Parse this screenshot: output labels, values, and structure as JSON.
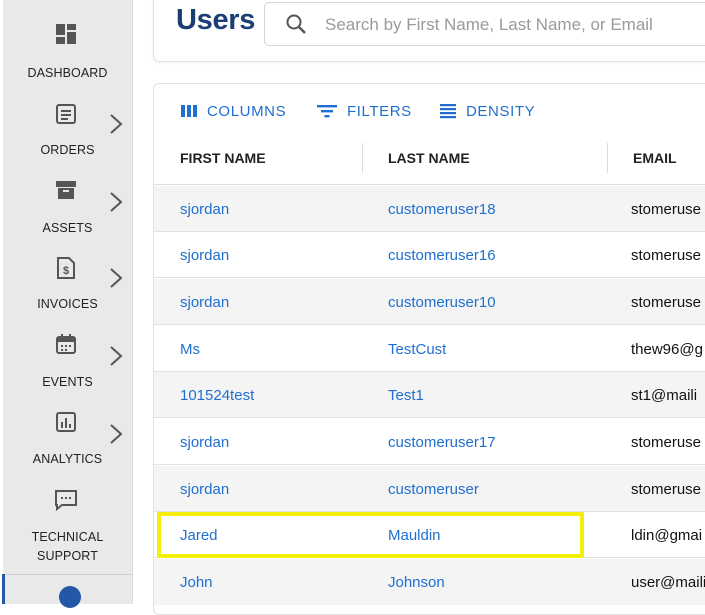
{
  "sidebar": {
    "items": [
      {
        "label": "DASHBOARD",
        "icon": "dashboard-icon",
        "has_submenu": false
      },
      {
        "label": "ORDERS",
        "icon": "orders-icon",
        "has_submenu": true
      },
      {
        "label": "ASSETS",
        "icon": "assets-icon",
        "has_submenu": true
      },
      {
        "label": "INVOICES",
        "icon": "invoices-icon",
        "has_submenu": true
      },
      {
        "label": "EVENTS",
        "icon": "calendar-icon",
        "has_submenu": true
      },
      {
        "label": "ANALYTICS",
        "icon": "analytics-icon",
        "has_submenu": true
      },
      {
        "label_line1": "TECHNICAL",
        "label_line2": "SUPPORT",
        "icon": "chat-icon",
        "has_submenu": false
      }
    ]
  },
  "header": {
    "title": "Users",
    "search_placeholder": "Search by First Name, Last Name, or Email"
  },
  "toolbar": {
    "columns_label": "COLUMNS",
    "filters_label": "FILTERS",
    "density_label": "DENSITY"
  },
  "table": {
    "columns": [
      "FIRST NAME",
      "LAST NAME",
      "EMAIL"
    ],
    "rows": [
      {
        "first": "sjordan",
        "last": "customeruser18",
        "email": "stomeruse"
      },
      {
        "first": "sjordan",
        "last": "customeruser16",
        "email": "stomeruse"
      },
      {
        "first": "sjordan",
        "last": "customeruser10",
        "email": "stomeruse"
      },
      {
        "first": "Ms",
        "last": "TestCust",
        "email": "thew96@g"
      },
      {
        "first": "101524test",
        "last": "Test1",
        "email": "st1@maili"
      },
      {
        "first": "sjordan",
        "last": "customeruser17",
        "email": "stomeruse"
      },
      {
        "first": "sjordan",
        "last": "customeruser",
        "email": "stomeruse"
      },
      {
        "first": "Jared",
        "last": "Mauldin",
        "email": "ldin@gmai"
      },
      {
        "first": "John",
        "last": "Johnson",
        "email": "user@maili"
      }
    ]
  },
  "colors": {
    "accent": "#1f6fd0",
    "title": "#1b3e75",
    "highlight": "#f3ef0a"
  }
}
